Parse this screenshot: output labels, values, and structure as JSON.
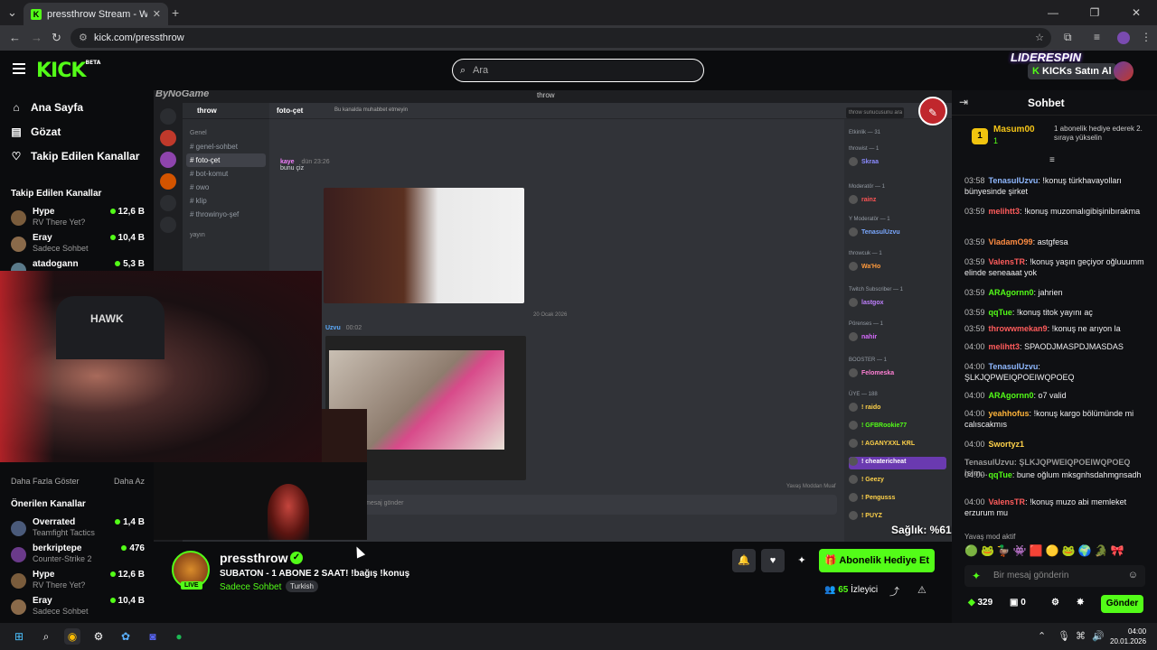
{
  "browser": {
    "tab_title": "pressthrow Stream - Watch Live",
    "url": "kick.com/pressthrow"
  },
  "header": {
    "logo": "KICK",
    "logo_badge": "BETA",
    "search_placeholder": "Ara",
    "brand_banner": "LIDERESPIN",
    "kicks_button": "KICKs Satın Al"
  },
  "sidebar": {
    "nav": [
      {
        "label": "Ana Sayfa",
        "icon": "home-icon"
      },
      {
        "label": "Gözat",
        "icon": "browse-icon"
      },
      {
        "label": "Takip Edilen Kanallar",
        "icon": "heart-icon"
      }
    ],
    "following_header": "Takip Edilen Kanallar",
    "following": [
      {
        "name": "Hype",
        "sub": "RV There Yet?",
        "viewers": "12,6 B"
      },
      {
        "name": "Eray",
        "sub": "Sadece Sohbet",
        "viewers": "10,4 B"
      },
      {
        "name": "atadogann",
        "sub": "",
        "viewers": "5,3 B"
      }
    ],
    "show_more": "Daha Fazla Göster",
    "show_less": "Daha Az",
    "recommended_header": "Önerilen Kanallar",
    "recommended": [
      {
        "name": "Overrated",
        "sub": "Teamfight Tactics",
        "viewers": "1,4 B"
      },
      {
        "name": "berkriptepe",
        "sub": "Counter-Strike 2",
        "viewers": "476"
      },
      {
        "name": "Hype",
        "sub": "RV There Yet?",
        "viewers": "12,6 B"
      },
      {
        "name": "Eray",
        "sub": "Sadece Sohbet",
        "viewers": "10,4 B"
      }
    ]
  },
  "video": {
    "watermark": "ByNoGame",
    "discord_window": "throw",
    "server_name": "throw",
    "channels": [
      {
        "label": "Genel",
        "header": true
      },
      {
        "label": "# genel-sohbet"
      },
      {
        "label": "# foto-çet",
        "active": true
      },
      {
        "label": "# bot-komut"
      },
      {
        "label": "# owo"
      },
      {
        "label": "# klip"
      },
      {
        "label": "# throwinyo-şef"
      },
      {
        "label": "yayın",
        "header": true
      }
    ],
    "channel_title": "foto-çet",
    "channel_desc": "Bu kanalda muhabbet etmeyin",
    "search_placeholder": "throw sunucusunu ara",
    "message1_user": "kaye",
    "message1_time": "dün 23:26",
    "message1_text": "bunu çiz",
    "date_separator": "20 Ocak 2026",
    "message2_user": "Uzvu",
    "message2_time": "00:02",
    "input_placeholder": "mesaj gönder",
    "slowmode": "Yavaş Moddan Muaf",
    "members": [
      {
        "section": "Etkinlik — 31"
      },
      {
        "section": "throwist — 1"
      },
      {
        "name": "Skraa"
      },
      {
        "section": "Moderatör — 1"
      },
      {
        "name": "rainz"
      },
      {
        "section": "Y Moderatör — 1"
      },
      {
        "name": "TenasulUzvu"
      },
      {
        "section": "throwcuk — 1"
      },
      {
        "name": "Wa'Ho"
      },
      {
        "section": "Twitch Subscriber — 1"
      },
      {
        "name": "lastgox"
      },
      {
        "section": "Pörenses — 1"
      },
      {
        "name": "nahir"
      },
      {
        "section": "BOOSTER — 1"
      },
      {
        "name": "Felomeska"
      },
      {
        "section": "ÜYE — 188"
      },
      {
        "name": "! raido"
      },
      {
        "name": "! GFBRookie77"
      },
      {
        "name": "! AGANYXXL KRL"
      },
      {
        "name": "! cheatericheat"
      },
      {
        "name": "! Geezy"
      },
      {
        "name": "! Pengusss"
      },
      {
        "name": "! PUYZ"
      }
    ],
    "overlay_health": "Sağlık: %61",
    "webcam_logo": "HAWK"
  },
  "stream": {
    "streamer": "pressthrow",
    "live_badge": "LIVE",
    "title": "SUBATON - 1 ABONE 2 SAAT! !bağış !konuş",
    "category": "Sadece Sohbet",
    "tag": "Turkish",
    "gift_sub_button": "Abonelik Hediye Et",
    "viewers": "65",
    "viewers_label": "İzleyici"
  },
  "chat": {
    "title": "Sohbet",
    "pinned": {
      "rank": "1",
      "user": "Masum00",
      "count": "1",
      "desc": "1 abonelik hediye ederek 2. sıraya yükselin"
    },
    "messages": [
      {
        "time": "03:58",
        "user": "TenasulUzvu",
        "color": "#8fb8ff",
        "text": "!konuş türkhavayolları bünyesinde şirket"
      },
      {
        "time": "03:59",
        "user": "melihtt3",
        "color": "#ff5c5c",
        "text": "!konuş muzomalıgibişinibırakma"
      },
      {
        "time": "03:59",
        "user": "VladamO99",
        "color": "#ff8c42",
        "text": "astgfesa"
      },
      {
        "time": "03:59",
        "user": "ValensTR",
        "color": "#ff5c5c",
        "text": "!konuş yaşın geçiyor oğluuumm elinde seneaaat yok"
      },
      {
        "time": "03:59",
        "user": "ARAgornn0",
        "color": "#53fc18",
        "text": "jahrien"
      },
      {
        "time": "03:59",
        "user": "qqTue",
        "color": "#53fc18",
        "text": "!konuş titok yayını aç"
      },
      {
        "time": "03:59",
        "user": "throwwmekan9",
        "color": "#ff5c5c",
        "text": "!konuş ne arıyon la"
      },
      {
        "time": "04:00",
        "user": "melihtt3",
        "color": "#ff5c5c",
        "text": "SPAODJMASPDJMASDAS"
      },
      {
        "time": "04:00",
        "user": "TenasulUzvu",
        "color": "#8fb8ff",
        "text": "ŞLKJQPWEIQPOEIWQPOEQ"
      },
      {
        "time": "04:00",
        "user": "ARAgornn0",
        "color": "#53fc18",
        "text": "o7 valid"
      },
      {
        "time": "04:00",
        "user": "yeahhofus",
        "color": "#ffb43a",
        "text": "!konuş kargo bölümünde mi calıscakmıs"
      },
      {
        "time": "04:00",
        "user": "Swortyz1",
        "color": "#ffd24a",
        "text": ""
      },
      {
        "time": "",
        "user": "TenasulUzvu: ŞLKJQPWEIQPOEIWQPOEQ isim...",
        "color": "#999999",
        "text": ""
      },
      {
        "time": "04:00",
        "user": "qqTue",
        "color": "#53fc18",
        "text": "bune oğlum mksgnhsdahmgnsadh"
      },
      {
        "time": "04:00",
        "user": "ValensTR",
        "color": "#ff5c5c",
        "text": "!konuş muzo abi memleket erzurum mu"
      }
    ],
    "mod_active": "Yavaş mod aktif",
    "input_placeholder": "Bir mesaj gönderin",
    "points": "329",
    "count2": "0",
    "send_button": "Gönder"
  },
  "taskbar": {
    "time": "04:00",
    "date": "20.01.2026"
  },
  "colors": {
    "kick_green": "#53fc18",
    "bg": "#0b0c0e"
  }
}
